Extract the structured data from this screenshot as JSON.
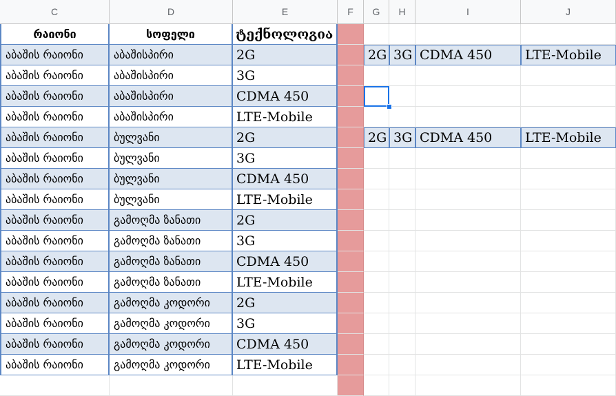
{
  "columns": [
    "C",
    "D",
    "E",
    "F",
    "G",
    "H",
    "I",
    "J"
  ],
  "headers": [
    "რაიონი",
    "სოფელი",
    "ტექნოლოგია"
  ],
  "rows": [
    [
      "აბაშის რაიონი",
      "აბაშისპირი",
      "2G"
    ],
    [
      "აბაშის რაიონი",
      "აბაშისპირი",
      "3G"
    ],
    [
      "აბაშის რაიონი",
      "აბაშისპირი",
      "CDMA 450"
    ],
    [
      "აბაშის რაიონი",
      "აბაშისპირი",
      "LTE-Mobile"
    ],
    [
      "აბაშის რაიონი",
      "ბულვანი",
      "2G"
    ],
    [
      "აბაშის რაიონი",
      "ბულვანი",
      "3G"
    ],
    [
      "აბაშის რაიონი",
      "ბულვანი",
      "CDMA 450"
    ],
    [
      "აბაშის რაიონი",
      "ბულვანი",
      "LTE-Mobile"
    ],
    [
      "აბაშის რაიონი",
      "გამოღმა ზანათი",
      "2G"
    ],
    [
      "აბაშის რაიონი",
      "გამოღმა ზანათი",
      "3G"
    ],
    [
      "აბაშის რაიონი",
      "გამოღმა ზანათი",
      "CDMA 450"
    ],
    [
      "აბაშის რაიონი",
      "გამოღმა ზანათი",
      "LTE-Mobile"
    ],
    [
      "აბაშის რაიონი",
      "გამოღმა კოდორი",
      "2G"
    ],
    [
      "აბაშის რაიონი",
      "გამოღმა კოდორი",
      "3G"
    ],
    [
      "აბაშის რაიონი",
      "გამოღმა კოდორი",
      "CDMA 450"
    ],
    [
      "აბაშის რაიონი",
      "გამოღმა კოდორი",
      "LTE-Mobile"
    ]
  ],
  "transposed_row_1": [
    "2G",
    "3G",
    "CDMA 450",
    "LTE-Mobile"
  ],
  "transposed_row_2": [
    "2G",
    "3G",
    "CDMA 450",
    "LTE-Mobile"
  ],
  "colors": {
    "band_blue": "#dde6f1",
    "separator_column": "#e69b9b",
    "selection": "#1a73e8",
    "table_border": "#5b86c4"
  }
}
